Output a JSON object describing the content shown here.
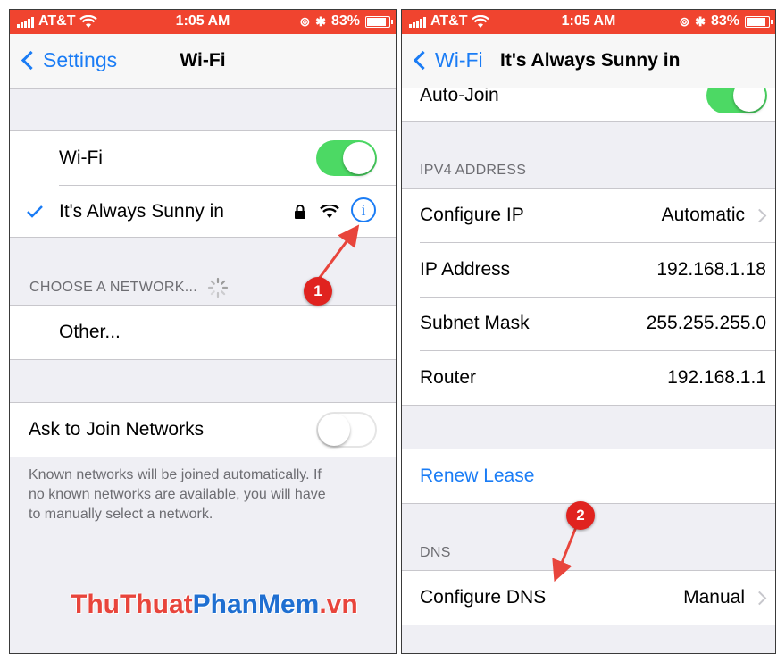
{
  "left": {
    "status": {
      "carrier": "AT&T",
      "time": "1:05 AM",
      "battery": "83%"
    },
    "nav": {
      "back_label": "Settings",
      "title": "Wi-Fi"
    },
    "wifi_row": {
      "label": "Wi-Fi",
      "toggle_on": true
    },
    "connected_network": {
      "name": "It's Always Sunny in"
    },
    "choose_header": "CHOOSE A NETWORK...",
    "other_row": "Other...",
    "ask_join": {
      "label": "Ask to Join Networks",
      "toggle_on": false
    },
    "footer": [
      "Known networks will be joined automatically. If",
      "no known networks are available, you will have",
      "to manually select a network."
    ]
  },
  "right": {
    "status": {
      "carrier": "AT&T",
      "time": "1:05 AM",
      "battery": "83%"
    },
    "nav": {
      "back_label": "Wi-Fi",
      "title": "It's Always Sunny in"
    },
    "auto_join": {
      "label": "Auto-Join",
      "toggle_on": true
    },
    "ipv4_header": "IPV4 ADDRESS",
    "ipv4_rows": [
      {
        "label": "Configure IP",
        "value": "Automatic"
      },
      {
        "label": "IP Address",
        "value": "192.168.1.18"
      },
      {
        "label": "Subnet Mask",
        "value": "255.255.255.0"
      },
      {
        "label": "Router",
        "value": "192.168.1.1"
      }
    ],
    "renew_lease": "Renew Lease",
    "dns_header": "DNS",
    "configure_dns": {
      "label": "Configure DNS",
      "value": "Manual"
    }
  },
  "annotations": {
    "badge_1": "1",
    "badge_2": "2",
    "arrow_color": "#e8453c"
  },
  "watermark": {
    "part1": "ThuThuat",
    "part2": "PhanMem",
    "part3": ".vn"
  },
  "colors": {
    "status_bar": "#f0442f",
    "ios_blue": "#1a7cf5",
    "toggle_green": "#4cd964"
  }
}
